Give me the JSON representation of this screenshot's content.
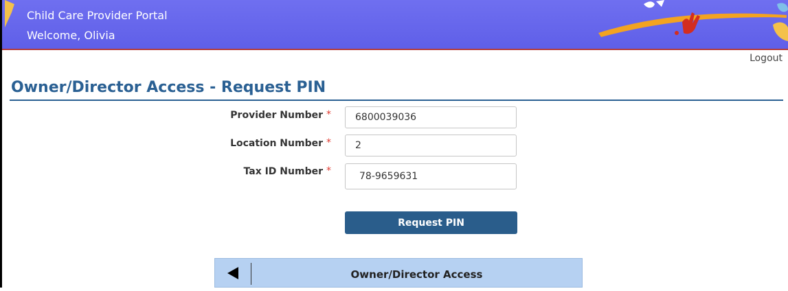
{
  "header": {
    "title": "Child Care Provider Portal",
    "welcome": "Welcome, Olivia"
  },
  "logout": "Logout",
  "page_title": "Owner/Director Access - Request PIN",
  "form": {
    "provider_label": "Provider Number",
    "provider_value": "6800039036",
    "location_label": "Location Number",
    "location_value": "2",
    "tax_label": "Tax ID Number",
    "tax_value": "78-9659631",
    "required_mark": "*"
  },
  "request_button": "Request PIN",
  "bottom_nav": {
    "label": "Owner/Director Access",
    "back_icon": "left-triangle-icon"
  },
  "colors": {
    "header_bg": "#6464ec",
    "title": "#2a6093",
    "button": "#2a5d8b",
    "nav_bg": "#b6d1f2",
    "required": "#e0392f"
  }
}
